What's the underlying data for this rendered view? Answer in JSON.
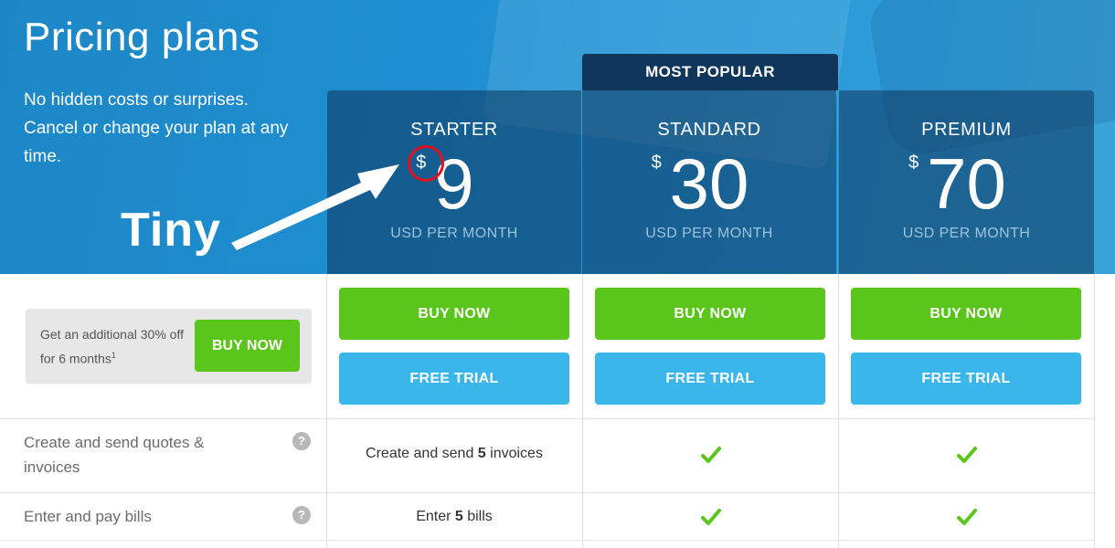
{
  "hero": {
    "title": "Pricing plans",
    "subtitle": "No hidden costs or surprises. Cancel or change your plan at any time.",
    "annotation": "Tiny"
  },
  "popular_badge": "MOST POPULAR",
  "plans": [
    {
      "name": "STARTER",
      "currency": "$",
      "price": "9",
      "period": "USD PER MONTH"
    },
    {
      "name": "STANDARD",
      "currency": "$",
      "price": "30",
      "period": "USD PER MONTH"
    },
    {
      "name": "PREMIUM",
      "currency": "$",
      "price": "70",
      "period": "USD PER MONTH"
    }
  ],
  "promo": {
    "text": "Get an additional 30% off for 6 months",
    "footnote": "1",
    "button": "BUY NOW"
  },
  "buttons": {
    "buy": "BUY NOW",
    "trial": "FREE TRIAL"
  },
  "features": [
    {
      "label": "Create and send quotes & invoices",
      "starter_pre": "Create and send ",
      "starter_num": "5",
      "starter_post": " invoices"
    },
    {
      "label": "Enter and pay bills",
      "starter_pre": "Enter ",
      "starter_num": "5",
      "starter_post": " bills"
    }
  ],
  "help_glyph": "?",
  "colors": {
    "hero_blue": "#1f8fd1",
    "plan_header": "#0c345c",
    "buy_green": "#5ac51a",
    "trial_blue": "#3bb6ea",
    "check_green": "#5ac51a",
    "annotation_circle": "#e0101e"
  }
}
